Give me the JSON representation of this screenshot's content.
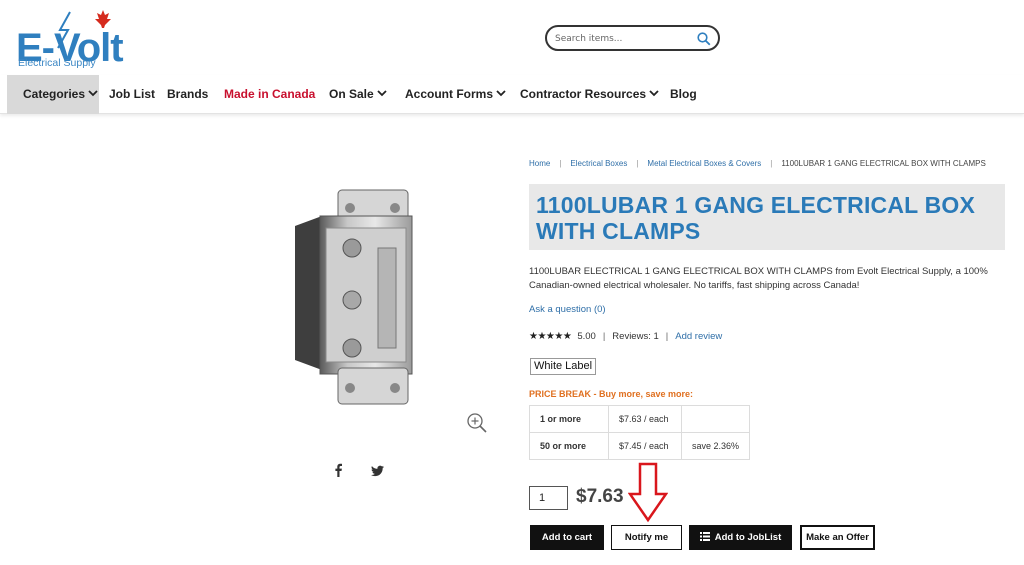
{
  "brand": {
    "logo_text": "E-Volt",
    "logo_subtitle": "Electrical Supply",
    "logo_accent_color": "#2f7fbf",
    "flag_color": "#d52b1e"
  },
  "search": {
    "placeholder": "Search items...",
    "value": ""
  },
  "nav": {
    "items": [
      {
        "label": "Categories",
        "has_dropdown": true,
        "active": true
      },
      {
        "label": "Job List"
      },
      {
        "label": "Brands"
      },
      {
        "label": "Made in Canada",
        "color": "#c8102e"
      },
      {
        "label": "On Sale",
        "has_dropdown": true
      },
      {
        "label": "Account Forms",
        "has_dropdown": true
      },
      {
        "label": "Contractor Resources",
        "has_dropdown": true
      },
      {
        "label": "Blog"
      }
    ]
  },
  "breadcrumb": {
    "items": [
      "Home",
      "Electrical Boxes",
      "Metal Electrical Boxes & Covers"
    ],
    "current": "1100LUBAR 1 GANG ELECTRICAL BOX WITH CLAMPS"
  },
  "product": {
    "title": "1100LUBAR 1 GANG ELECTRICAL BOX WITH CLAMPS",
    "description": "1100LUBAR ELECTRICAL 1 GANG ELECTRICAL BOX WITH CLAMPS from Evolt Electrical Supply, a 100% Canadian-owned electrical wholesaler. No tariffs, fast shipping across Canada!",
    "ask_question": "Ask a question (0)",
    "rating_score": "5.00",
    "rating_stars": 5,
    "reviews": "Reviews: 1",
    "add_review": "Add review",
    "brand_label": "White Label",
    "image_icon": "metal-electrical-box-image",
    "share_icons": [
      "facebook-icon",
      "twitter-icon"
    ]
  },
  "price_break": {
    "title": "PRICE BREAK - Buy more, save more:",
    "rows": [
      {
        "qty": "1 or more",
        "price": "$7.63 / each",
        "save": ""
      },
      {
        "qty": "50 or more",
        "price": "$7.45 / each",
        "save": "save 2.36%"
      }
    ]
  },
  "purchase": {
    "quantity": "1",
    "price": "$7.63",
    "buttons": {
      "add_to_cart": "Add to cart",
      "notify_me": "Notify me",
      "add_to_joblist": "Add to JobList",
      "make_offer": "Make an Offer"
    },
    "annotation_color": "#d9161c"
  }
}
